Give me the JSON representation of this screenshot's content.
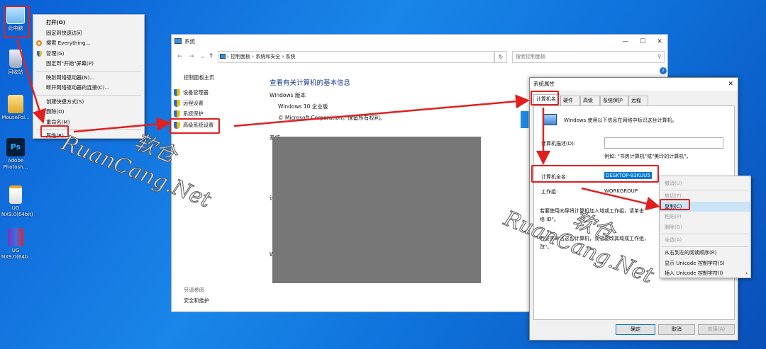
{
  "desktop": {
    "icons": [
      {
        "label": "此电脑",
        "icon": "computer-icon"
      },
      {
        "label": "回收站",
        "icon": "recycle-bin-icon"
      },
      {
        "label": "MouseFol...",
        "icon": "folder-icon"
      },
      {
        "label": "Adobe Photosh...",
        "icon": "photoshop-icon"
      },
      {
        "label": "UG NX9.0(64bit)",
        "icon": "ug-icon"
      },
      {
        "label": "UG NX9.0(64b...",
        "icon": "archive-icon"
      }
    ]
  },
  "context_menu": {
    "items": [
      "打开(O)",
      "固定到快速访问",
      "搜索 Everything...",
      "管理(G)",
      "固定到\"开始\"屏幕(P)",
      "映射网络驱动器(N)...",
      "断开网络驱动器的连接(C)...",
      "创建快捷方式(S)",
      "删除(D)",
      "重命名(M)",
      "属性(R)"
    ]
  },
  "system_window": {
    "title": "系统",
    "breadcrumb": [
      "控制面板",
      "系统和安全",
      "系统"
    ],
    "search_placeholder": "搜索控制面板",
    "left_pane": {
      "home": "控制面板主页",
      "links": [
        "设备管理器",
        "远程设置",
        "系统保护",
        "高级系统设置"
      ],
      "see_also": "另请参阅",
      "security": "安全和维护"
    },
    "heading": "查看有关计算机的基本信息",
    "edition_label": "Windows 版本",
    "edition": "Windows 10 企业版",
    "copyright": "© Microsoft Corporation。保留所有权利。",
    "section_system": "系统",
    "section_computer": "计",
    "section_windows": "W"
  },
  "dialog": {
    "title": "系统属性",
    "tabs": [
      "计算机名",
      "硬件",
      "高级",
      "系统保护",
      "远程"
    ],
    "intro": "Windows 使用以下信息在网络中标识这台计算机。",
    "description_label": "计算机描述(D):",
    "example": "例如: \"书房计算机\"或\"美玲的计算机\"。",
    "full_name_label": "计算机全名:",
    "full_name_value": "DESKTOP-83KUU5",
    "workgroup_label": "工作组:",
    "workgroup_value": "WORKGROUP",
    "para1": "若要使用向导将计算机加入域或工作组，请单击",
    "para1b": "络 ID\"。",
    "para2": "若要重命名这台计算机，或者更改其域或工作组，",
    "para2b": "改\"。",
    "ok": "确定",
    "cancel": "取消",
    "apply": "应用(A)"
  },
  "edit_menu": {
    "items": [
      {
        "label": "撤消(U)",
        "state": "disabled"
      },
      {
        "label": "剪切(T)",
        "state": "disabled"
      },
      {
        "label": "复制(C)",
        "state": "highlight"
      },
      {
        "label": "粘贴(P)",
        "state": "disabled"
      },
      {
        "label": "删除(D)",
        "state": "disabled"
      },
      {
        "label": "全选(A)",
        "state": "disabled"
      },
      {
        "label": "从右到左的阅读顺序(R)",
        "state": "normal"
      },
      {
        "label": "显示 Unicode 控制字符(S)",
        "state": "normal"
      },
      {
        "label": "插入 Unicode 控制字符(I)",
        "state": "normal"
      }
    ]
  },
  "watermark": {
    "brand": "RuanCang.Net",
    "cn": "软仓"
  },
  "colors": {
    "accent": "#0078d7",
    "annotation": "#e02020"
  }
}
